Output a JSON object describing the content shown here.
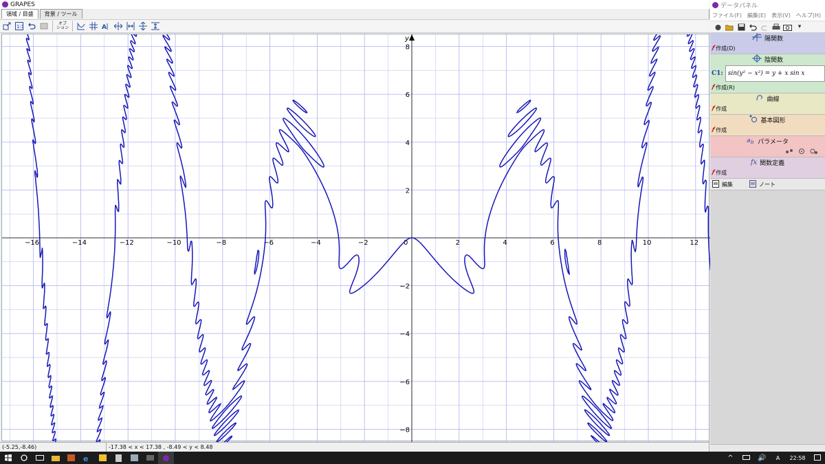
{
  "app": {
    "title": "GRAPES",
    "tabs": [
      "領域 / 目盛",
      "背景 / ツール"
    ],
    "toolbar_icons": [
      "zoom-rect-icon",
      "scale-1-1-icon",
      "undo-view-icon",
      "redo-view-icon",
      "options-icon",
      "curve-tool-icon",
      "grid-icon",
      "label-icon",
      "expand-x-icon",
      "shrink-x-icon",
      "expand-y-icon",
      "shrink-y-icon"
    ],
    "toolbar_option_label": "オプ\nション"
  },
  "graph": {
    "y_axis_label": "y",
    "x_ticks": [
      "−16",
      "−14",
      "−12",
      "−10",
      "−8",
      "−6",
      "−4",
      "−2",
      "0",
      "2",
      "4",
      "6",
      "8",
      "10",
      "12"
    ],
    "y_ticks": [
      "8",
      "6",
      "4",
      "2",
      "−2",
      "−4",
      "−6",
      "−8"
    ],
    "curve_color": "#1515b8",
    "grid_color": "#b8b8f0",
    "equation": "sin(y² − x²) = y + x sin x"
  },
  "status": {
    "cursor": "(-5.25,-8.46)",
    "range": "-17.38 < x <  17.38 ,  -8.49 < y <  8.48"
  },
  "panel": {
    "title": "データパネル",
    "menu": [
      "ファイル(F)",
      "編集(E)",
      "表示(V)",
      "ヘルプ(H)"
    ],
    "sections": {
      "explicit": {
        "title": "陽関数",
        "create": "作成(D)",
        "color": "#c9cbe8"
      },
      "implicit": {
        "title": "陰関数",
        "create": "作成(R)",
        "color": "#cde8cd",
        "label": "C1:"
      },
      "curve": {
        "title": "曲線",
        "create": "作成",
        "color": "#e8e8c4"
      },
      "shape": {
        "title": "基本図形",
        "create": "作成",
        "color": "#f2dcc0"
      },
      "param": {
        "title": "パラメータ",
        "color": "#f2c4c4"
      },
      "func": {
        "title": "関数定義",
        "create": "作成",
        "color": "#e0cfe0"
      }
    },
    "bottom": {
      "edit": "編集",
      "note": "ノート"
    }
  },
  "taskbar": {
    "time": "22:58"
  }
}
